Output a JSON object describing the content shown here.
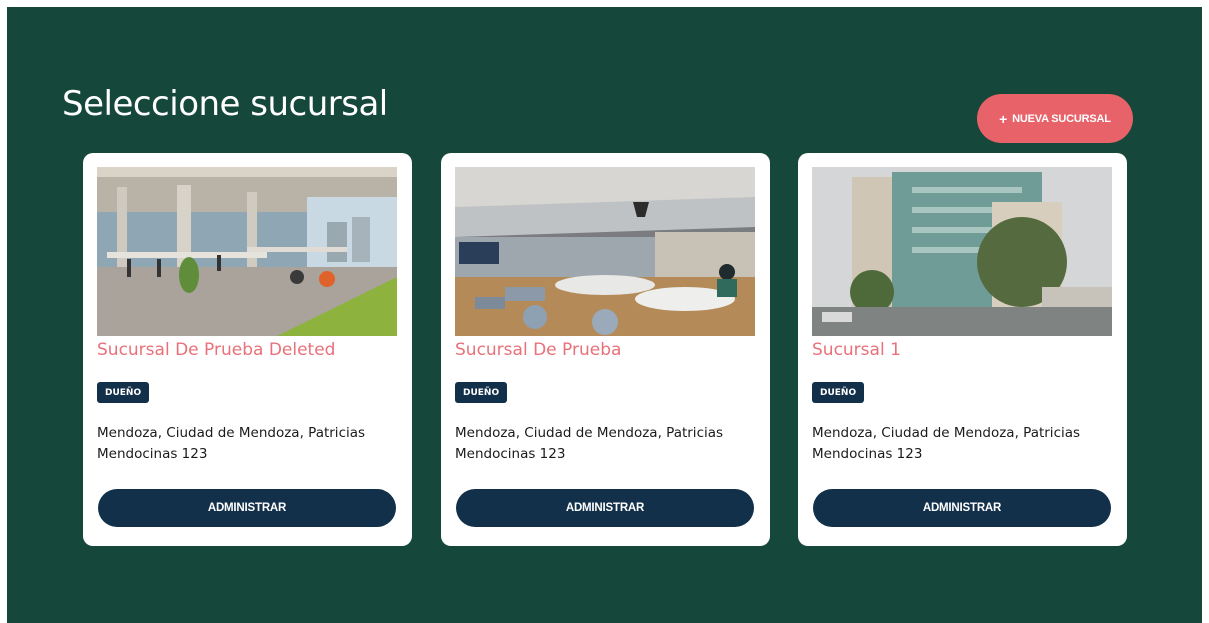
{
  "header": {
    "title": "Seleccione sucursal",
    "new_button_icon": "+",
    "new_button_label": "NUEVA SUCURSAL"
  },
  "colors": {
    "background": "#15473a",
    "accent": "#e8626a",
    "title_pink": "#e8717a",
    "navy": "#13304a"
  },
  "branches": [
    {
      "name": "Sucursal De Prueba Deleted",
      "role": "DUEÑO",
      "address": "Mendoza, Ciudad de Mendoza, Patricias Mendocinas 123",
      "action": "ADMINISTRAR",
      "image": "open-office-photo"
    },
    {
      "name": "Sucursal De Prueba",
      "role": "DUEÑO",
      "address": "Mendoza, Ciudad de Mendoza, Patricias Mendocinas 123",
      "action": "ADMINISTRAR",
      "image": "lounge-photo"
    },
    {
      "name": "Sucursal 1",
      "role": "DUEÑO",
      "address": "Mendoza, Ciudad de Mendoza, Patricias Mendocinas 123",
      "action": "ADMINISTRAR",
      "image": "building-photo"
    }
  ]
}
